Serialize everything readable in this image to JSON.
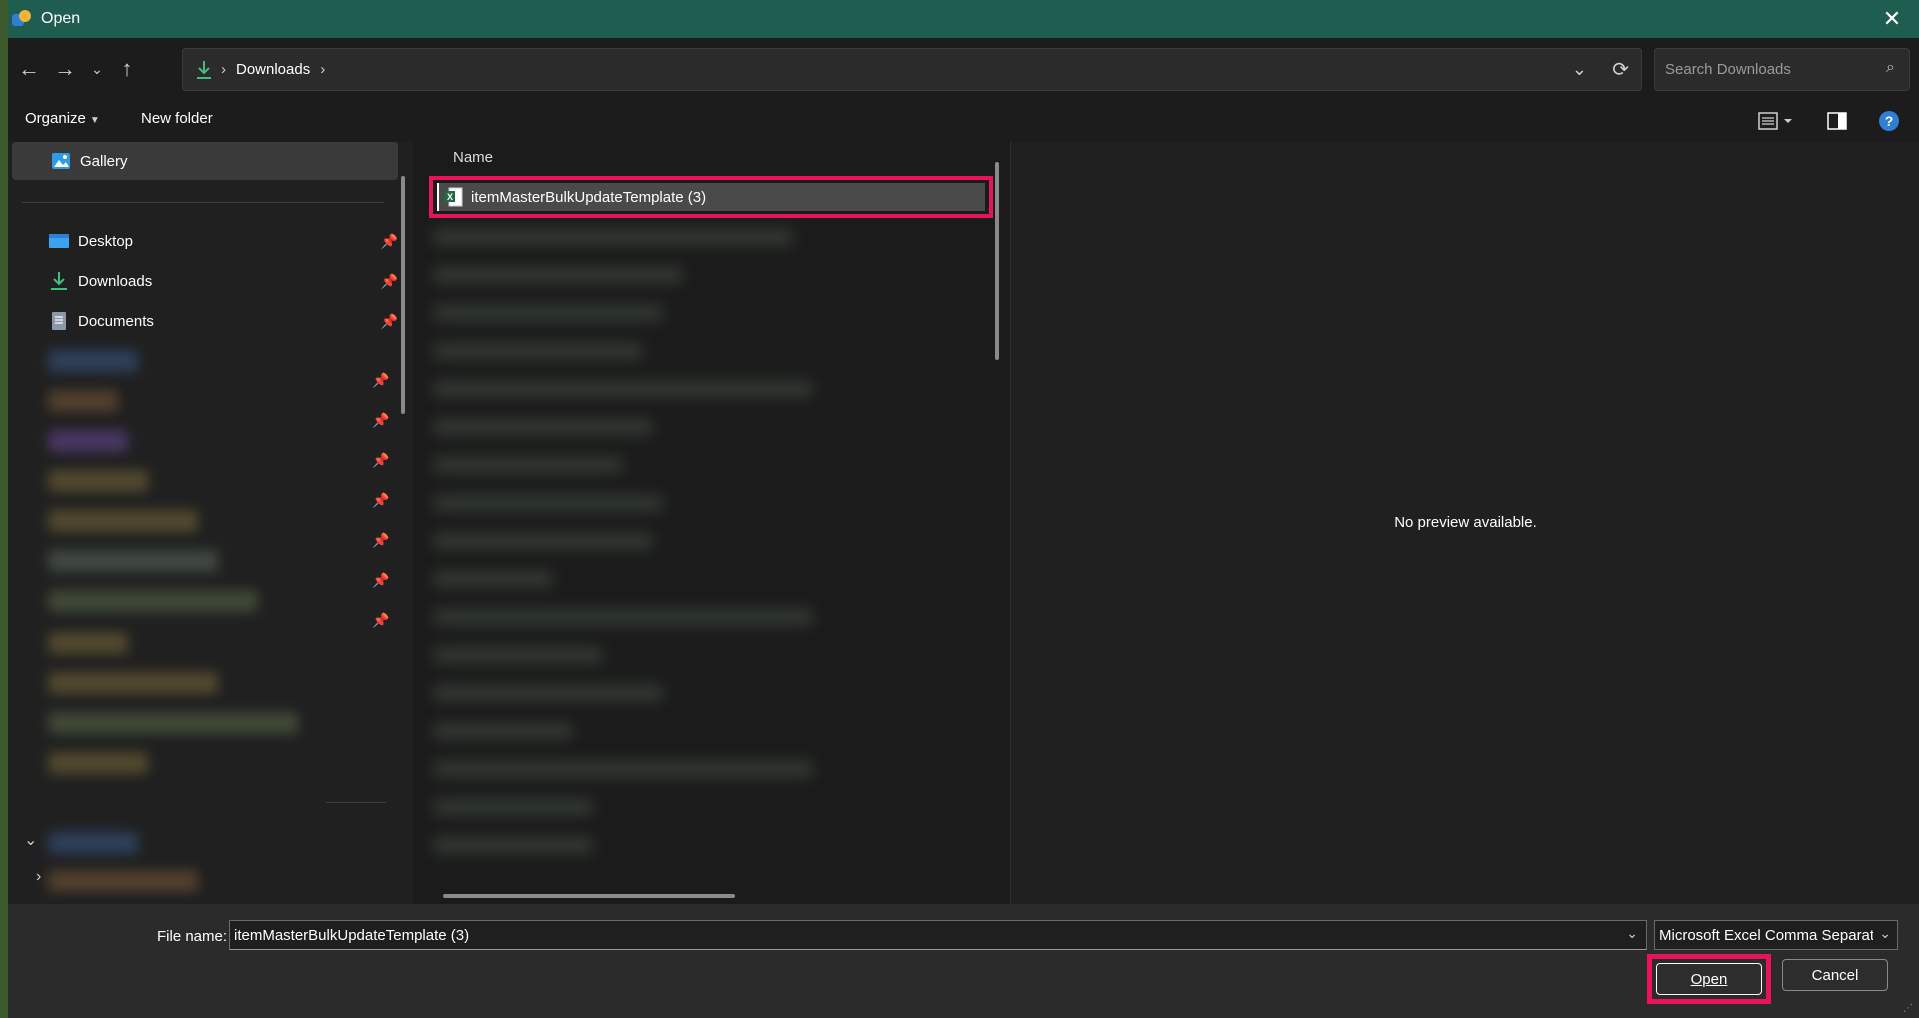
{
  "window": {
    "title": "Open"
  },
  "navigation": {
    "back_icon": "arrow-left-icon",
    "forward_icon": "arrow-right-icon",
    "recent_icon": "chevron-down-icon",
    "up_icon": "arrow-up-icon"
  },
  "address": {
    "location_icon": "download-icon",
    "separator": "›",
    "crumb": "Downloads",
    "trailing_separator": "›"
  },
  "search": {
    "placeholder": "Search Downloads"
  },
  "toolbar": {
    "organize_label": "Organize",
    "new_folder_label": "New folder"
  },
  "nav_pane": {
    "items": [
      {
        "label": "Gallery",
        "icon": "gallery-icon"
      },
      {
        "label": "Desktop",
        "icon": "desktop-icon"
      },
      {
        "label": "Downloads",
        "icon": "download-icon"
      },
      {
        "label": "Documents",
        "icon": "documents-icon"
      }
    ]
  },
  "file_list": {
    "column_header": "Name",
    "selected_file": "itemMasterBulkUpdateTemplate (3)"
  },
  "preview": {
    "message": "No preview available."
  },
  "footer": {
    "file_name_label": "File name:",
    "file_name_value": "itemMasterBulkUpdateTemplate (3)",
    "file_type_value": "Microsoft Excel Comma Separated",
    "open_label": "Open",
    "cancel_label": "Cancel"
  },
  "colors": {
    "titlebar": "#1e5d4f",
    "highlight": "#e8135d",
    "accent": "#2f7fd6"
  }
}
